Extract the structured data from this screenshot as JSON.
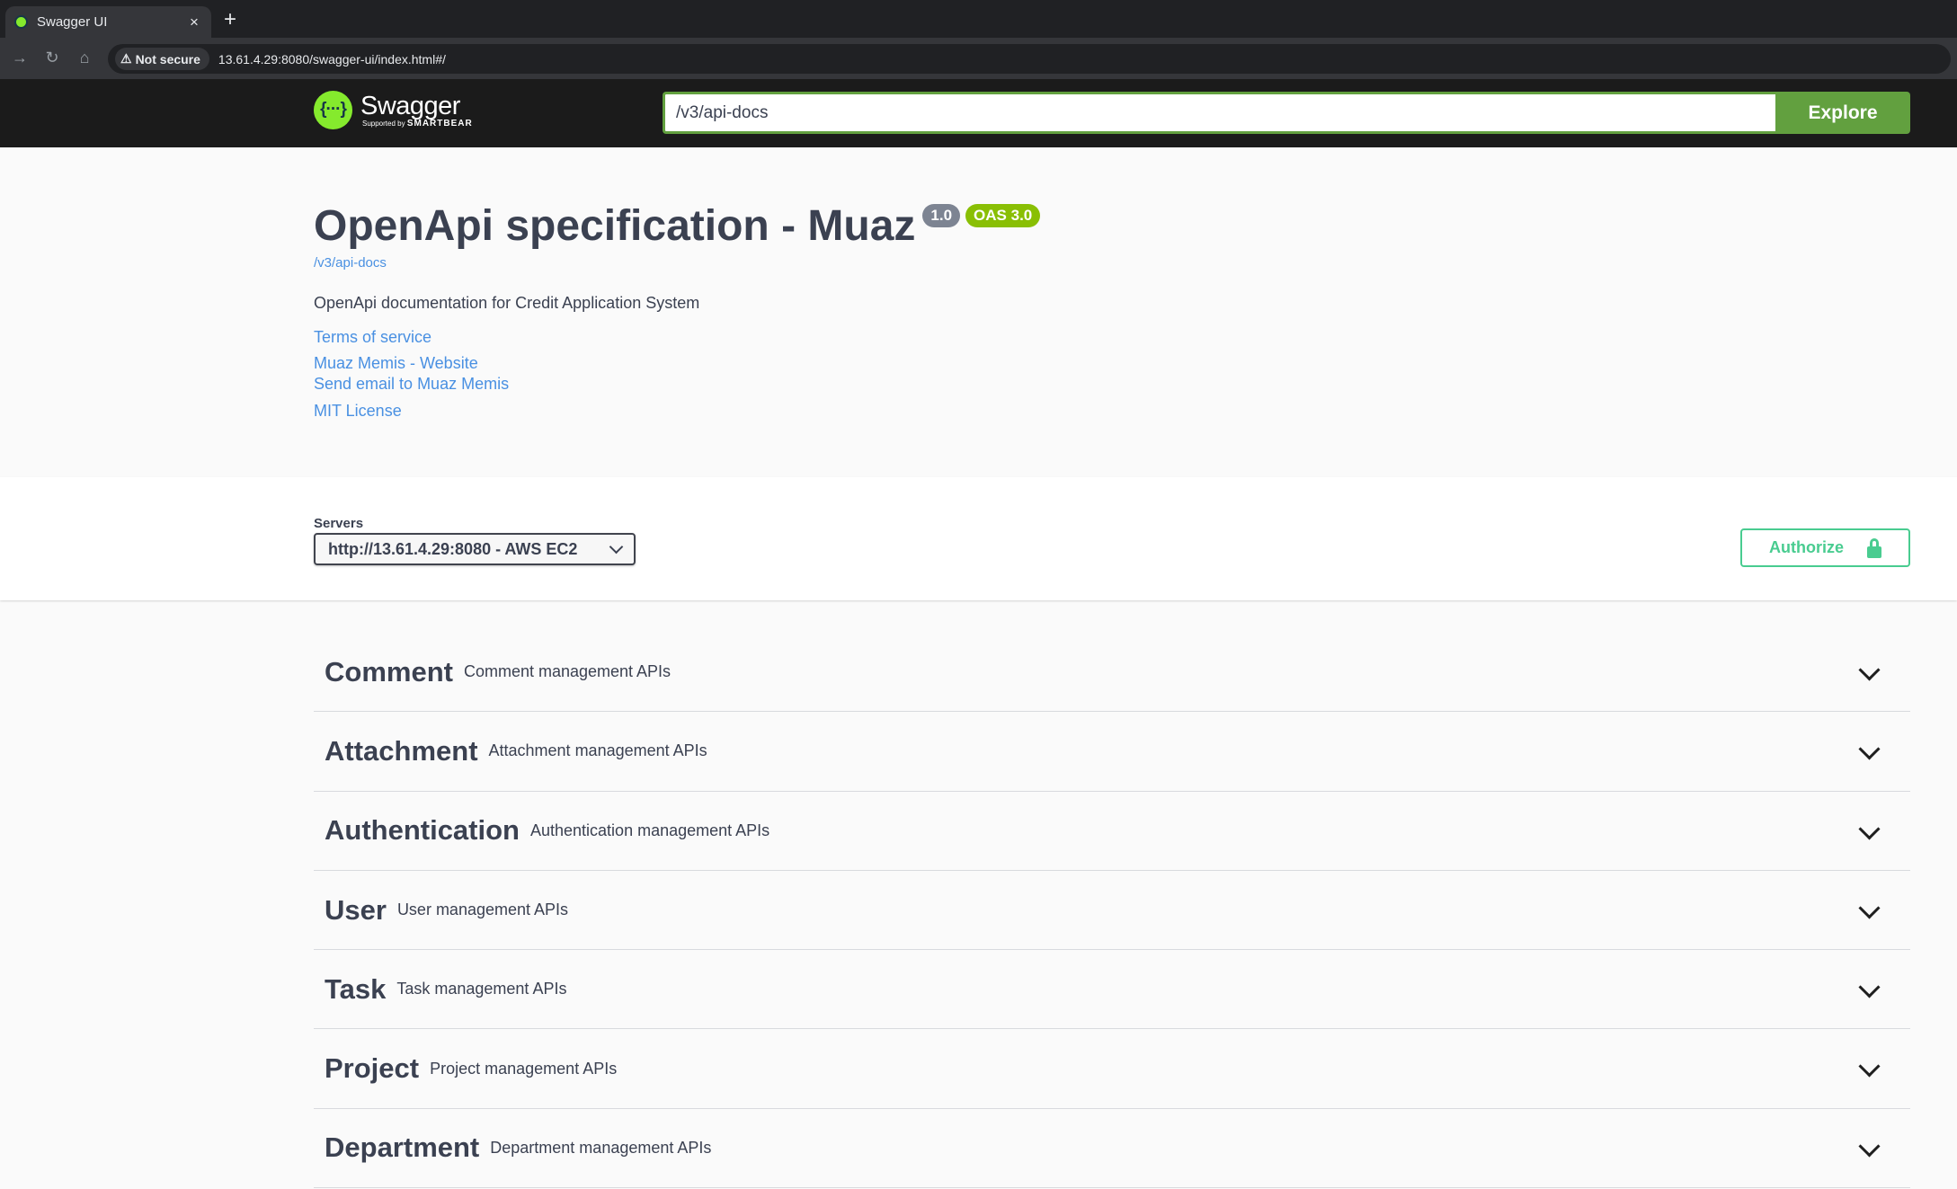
{
  "browser": {
    "tab_title": "Swagger UI",
    "tab_close": "×",
    "new_tab": "+",
    "security_label": "Not secure",
    "url": "13.61.4.29:8080/swagger-ui/index.html#/"
  },
  "topbar": {
    "logo_name": "Swagger",
    "logo_tagline_prefix": "Supported by",
    "logo_tagline_brand": "SMARTBEAR",
    "spec_url_value": "/v3/api-docs",
    "explore_label": "Explore",
    "colors": {
      "accent": "#62a03f",
      "logo": "#85ea2d"
    }
  },
  "info": {
    "title": "OpenApi specification - Muaz",
    "version": "1.0",
    "oas": "OAS 3.0",
    "spec_link": "/v3/api-docs",
    "description": "OpenApi documentation for Credit Application System",
    "terms": "Terms of service",
    "contact_website": "Muaz Memis - Website",
    "contact_email": "Send email to Muaz Memis",
    "license": "MIT License"
  },
  "servers": {
    "label": "Servers",
    "selected": "http://13.61.4.29:8080 - AWS EC2",
    "authorize_label": "Authorize"
  },
  "tags": [
    {
      "name": "Comment",
      "description": "Comment management APIs"
    },
    {
      "name": "Attachment",
      "description": "Attachment management APIs"
    },
    {
      "name": "Authentication",
      "description": "Authentication management APIs"
    },
    {
      "name": "User",
      "description": "User management APIs"
    },
    {
      "name": "Task",
      "description": "Task management APIs"
    },
    {
      "name": "Project",
      "description": "Project management APIs"
    },
    {
      "name": "Department",
      "description": "Department management APIs"
    }
  ]
}
